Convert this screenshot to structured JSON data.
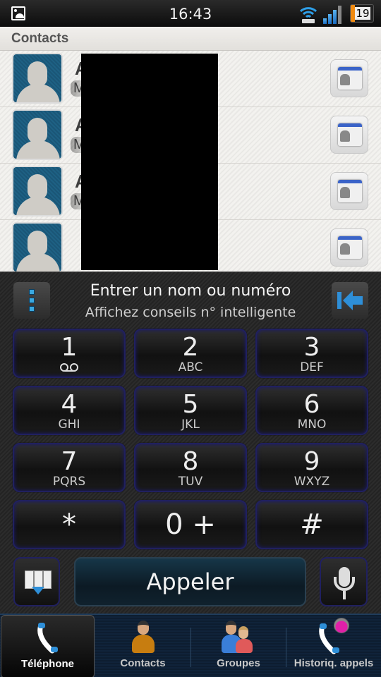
{
  "status_bar": {
    "time": "16:43",
    "battery_level": "19",
    "icons": [
      "gallery-notification-icon",
      "wifi-icon",
      "signal-icon",
      "battery-icon"
    ]
  },
  "contacts_panel": {
    "title": "Contacts",
    "rows": [
      {
        "name_initial": "A",
        "sub_initial": "M",
        "action_icon": "vcard-icon"
      },
      {
        "name_initial": "A",
        "sub_initial": "M",
        "action_icon": "vcard-icon"
      },
      {
        "name_initial": "A",
        "sub_initial": "M",
        "action_icon": "vcard-icon"
      },
      {
        "name_initial": "",
        "sub_initial": "",
        "action_icon": "vcard-icon"
      }
    ]
  },
  "dialer": {
    "input_title": "Entrer un nom ou numéro",
    "input_hint": "Affichez conseils n° intelligente",
    "keys": [
      {
        "digit": "1",
        "letters": ""
      },
      {
        "digit": "2",
        "letters": "ABC"
      },
      {
        "digit": "3",
        "letters": "DEF"
      },
      {
        "digit": "4",
        "letters": "GHI"
      },
      {
        "digit": "5",
        "letters": "JKL"
      },
      {
        "digit": "6",
        "letters": "MNO"
      },
      {
        "digit": "7",
        "letters": "PQRS"
      },
      {
        "digit": "8",
        "letters": "TUV"
      },
      {
        "digit": "9",
        "letters": "WXYZ"
      },
      {
        "digit": "*",
        "letters": ""
      },
      {
        "digit": "0 +",
        "letters": ""
      },
      {
        "digit": "#",
        "letters": ""
      }
    ],
    "call_label": "Appeler"
  },
  "tabs": [
    {
      "label": "Téléphone",
      "active": true
    },
    {
      "label": "Contacts",
      "active": false
    },
    {
      "label": "Groupes",
      "active": false
    },
    {
      "label": "Historiq. appels",
      "active": false
    }
  ],
  "colors": {
    "accent_blue": "#2e8fd8",
    "key_border": "#202060",
    "tabbar_bg": "#10233a",
    "avatar_bg": "#1e6184"
  }
}
